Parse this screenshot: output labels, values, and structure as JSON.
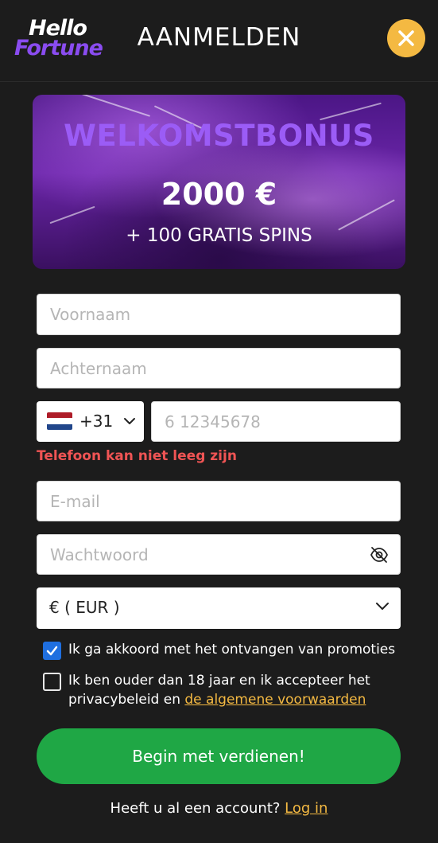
{
  "header": {
    "logo_line1": "Hello",
    "logo_line2": "Fortune",
    "title": "AANMELDEN",
    "close_icon": "close-icon"
  },
  "banner": {
    "title": "WELKOMSTBONUS",
    "amount": "2000 €",
    "spins": "+ 100 GRATIS SPINS"
  },
  "form": {
    "first_name_placeholder": "Voornaam",
    "last_name_placeholder": "Achternaam",
    "country_code": "+31",
    "phone_placeholder": "6 12345678",
    "phone_error": "Telefoon kan niet leeg zijn",
    "email_placeholder": "E-mail",
    "password_placeholder": "Wachtwoord",
    "currency_selected": "€ ( EUR )"
  },
  "consents": {
    "promotions_label": "Ik ga akkoord met het ontvangen van promoties",
    "promotions_checked": true,
    "age_label_prefix": "Ik ben ouder dan 18 jaar en ik accepteer het privacybeleid en ",
    "age_terms_link": "de algemene voorwaarden",
    "age_checked": false
  },
  "cta": {
    "label": "Begin met verdienen!"
  },
  "footer": {
    "prompt": "Heeft u al een account? ",
    "login_link": "Log in"
  },
  "colors": {
    "background": "#1c1c1c",
    "accent_yellow": "#f4b942",
    "cta_green": "#1fa745",
    "error_red": "#f05454",
    "brand_purple": "#8a4cf0"
  }
}
